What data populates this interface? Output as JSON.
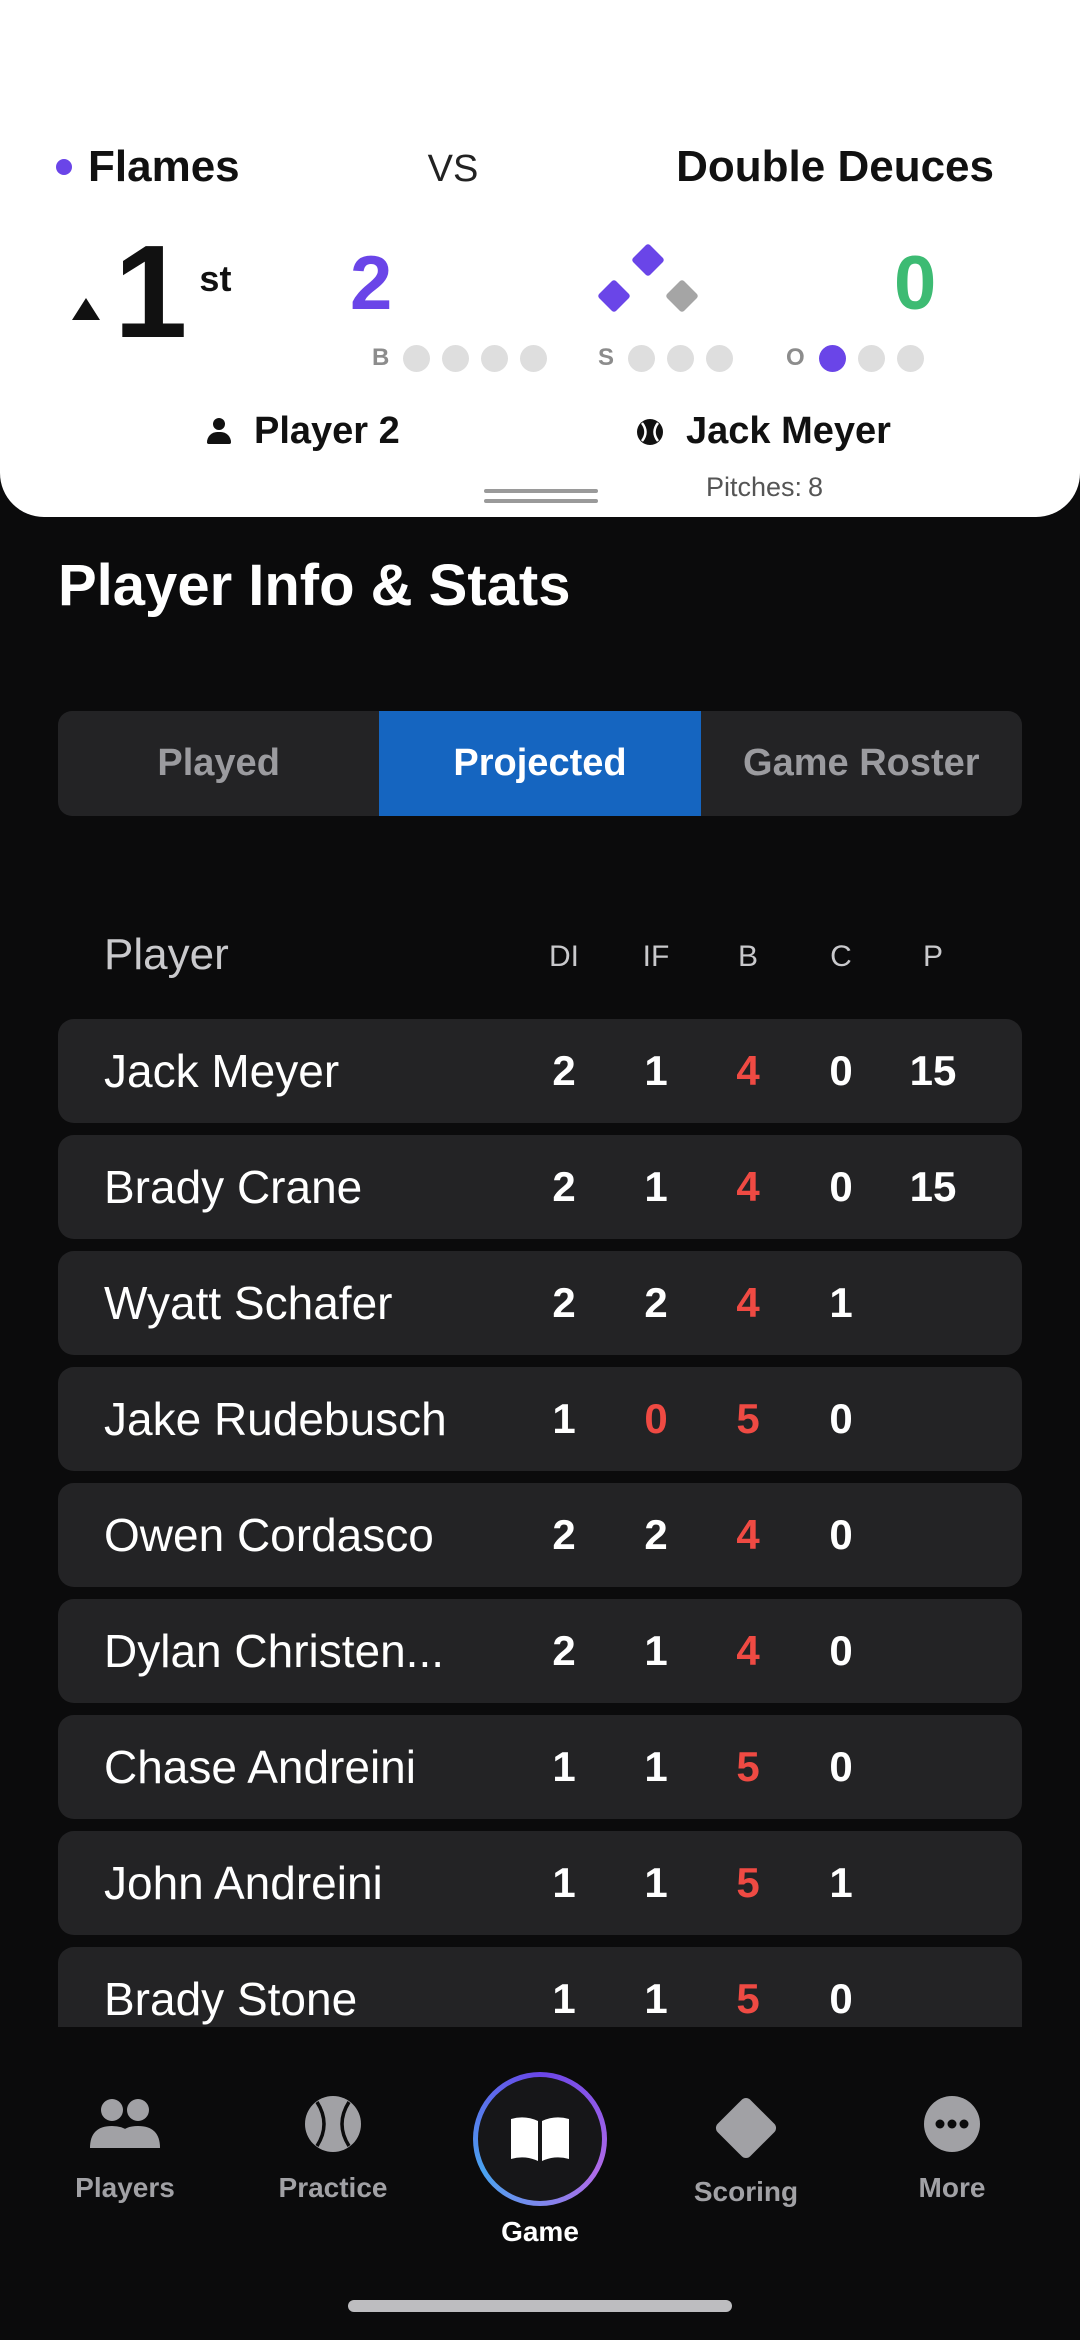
{
  "scoreboard": {
    "home_team": "Flames",
    "vs": "VS",
    "away_team": "Double Deuces",
    "inning_number": "1",
    "inning_suffix": "st",
    "home_score": "2",
    "away_score": "0",
    "balls_label": "B",
    "strikes_label": "S",
    "outs_label": "O",
    "balls": 0,
    "strikes": 0,
    "outs": 1,
    "batter": "Player 2",
    "pitcher": "Jack Meyer",
    "pitches_label": "Pitches:",
    "pitches_count": "8",
    "colors": {
      "home": "#6a45e8",
      "away": "#3dbb73"
    }
  },
  "section": {
    "title": "Player Info & Stats"
  },
  "tabs": [
    {
      "label": "Played",
      "active": false
    },
    {
      "label": "Projected",
      "active": true
    },
    {
      "label": "Game Roster",
      "active": false
    }
  ],
  "table": {
    "headers": {
      "player": "Player",
      "di": "DI",
      "if": "IF",
      "b": "B",
      "c": "C",
      "p": "P"
    },
    "rows": [
      {
        "name": "Jack Meyer",
        "di": "2",
        "if": "1",
        "b": "4",
        "c": "0",
        "p": "15"
      },
      {
        "name": "Brady Crane",
        "di": "2",
        "if": "1",
        "b": "4",
        "c": "0",
        "p": "15"
      },
      {
        "name": "Wyatt Schafer",
        "di": "2",
        "if": "2",
        "b": "4",
        "c": "1",
        "p": ""
      },
      {
        "name": "Jake Rudebusch",
        "di": "1",
        "if": "0",
        "b": "5",
        "c": "0",
        "p": ""
      },
      {
        "name": "Owen Cordasco",
        "di": "2",
        "if": "2",
        "b": "4",
        "c": "0",
        "p": ""
      },
      {
        "name": "Dylan Christen...",
        "di": "2",
        "if": "1",
        "b": "4",
        "c": "0",
        "p": ""
      },
      {
        "name": "Chase Andreini",
        "di": "1",
        "if": "1",
        "b": "5",
        "c": "0",
        "p": ""
      },
      {
        "name": "John Andreini",
        "di": "1",
        "if": "1",
        "b": "5",
        "c": "1",
        "p": ""
      },
      {
        "name": "Brady Stone",
        "di": "1",
        "if": "1",
        "b": "5",
        "c": "0",
        "p": ""
      }
    ]
  },
  "tabbar": {
    "players": "Players",
    "practice": "Practice",
    "game": "Game",
    "scoring": "Scoring",
    "more": "More"
  }
}
